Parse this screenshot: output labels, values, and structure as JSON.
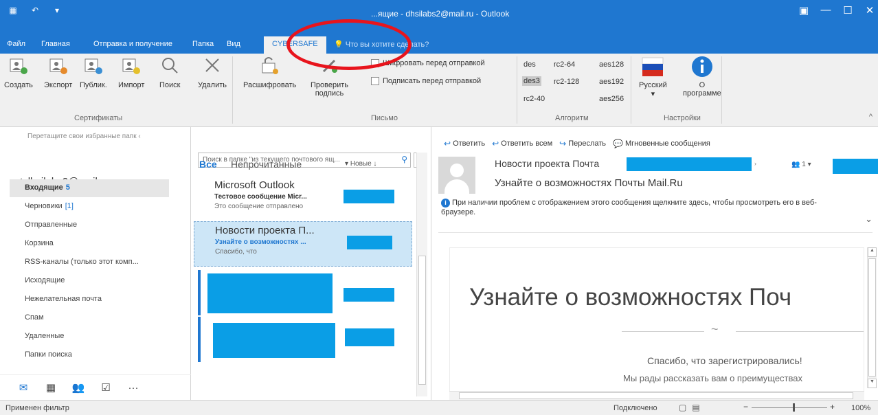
{
  "window": {
    "title": "...ящие - dhsilabs2@mail.ru - Outlook"
  },
  "tabs": [
    {
      "label": "Файл"
    },
    {
      "label": "Главная"
    },
    {
      "label": "Отправка и получение"
    },
    {
      "label": "Папка"
    },
    {
      "label": "Вид"
    },
    {
      "label": "CYBERSAFE"
    }
  ],
  "tell_me": "Что вы хотите сделать?",
  "ribbon": {
    "certs": {
      "create": "Создать",
      "export": "Экспорт",
      "publish": "Публик.",
      "import": "Импорт",
      "search": "Поиск",
      "delete": "Удалить",
      "group": "Сертификаты"
    },
    "letter": {
      "decrypt": "Расшифровать",
      "verify_1": "Проверить",
      "verify_2": "подпись",
      "encrypt_before_send": "Шифровать перед отправкой",
      "sign_before_send": "Подписать перед отправкой",
      "group": "Письмо"
    },
    "algorithm": {
      "col1": [
        "des",
        "des3",
        "rc2-40"
      ],
      "col2": [
        "rc2-64",
        "rc2-128"
      ],
      "col3": [
        "aes128",
        "aes192",
        "aes256"
      ],
      "selected": "des3",
      "group": "Алгоритм"
    },
    "settings": {
      "language": "Русский",
      "about_1": "О",
      "about_2": "программе",
      "group": "Настройки"
    }
  },
  "left": {
    "drag_tip": "Перетащите свои избранные папк",
    "account": "dhsilabs2@mail.ru",
    "folders": [
      {
        "label": "Входящие",
        "count": "5"
      },
      {
        "label": "Черновики",
        "count": "[1]"
      },
      {
        "label": "Отправленные"
      },
      {
        "label": "Корзина"
      },
      {
        "label": "RSS-каналы (только этот комп..."
      },
      {
        "label": "Исходящие"
      },
      {
        "label": "Нежелательная почта"
      },
      {
        "label": "Спам"
      },
      {
        "label": "Удаленные"
      },
      {
        "label": "Папки поиска"
      }
    ]
  },
  "list": {
    "search_placeholder": "Поиск в папке \"из текущего почтового ящ...",
    "filter_all": "Все",
    "filter_unread": "Непрочитанные",
    "sort": "Новые ↓",
    "messages": [
      {
        "sender": "Microsoft Outlook",
        "subject": "Тестовое сообщение Micr...",
        "preview": "Это сообщение отправлено"
      },
      {
        "sender": "Новости проекта П...",
        "subject": "Узнайте о возможностях ...",
        "preview": "Спасибо, что"
      }
    ]
  },
  "reading": {
    "actions": [
      "Ответить",
      "Ответить всем",
      "Переслать",
      "Мгновенные сообщения"
    ],
    "from": "Новости проекта Почта",
    "people": "1",
    "subject": "Узнайте о возможностях Почты Mail.Ru",
    "info": "При наличии проблем с отображением этого сообщения щелкните здесь, чтобы просмотреть его в веб-браузере.",
    "content_title": "Узнайте о возможностях Поч",
    "content_thanks": "Спасибо, что зарегистрировались!",
    "content_more": "Мы рады рассказать вам о преимуществах"
  },
  "status": {
    "left": "Применен фильтр",
    "connection": "Подключено",
    "zoom": "100%"
  },
  "colors": {
    "accent": "#1f77d0",
    "redaction": "#0a9ee6",
    "highlight_ring": "#e8141c"
  }
}
